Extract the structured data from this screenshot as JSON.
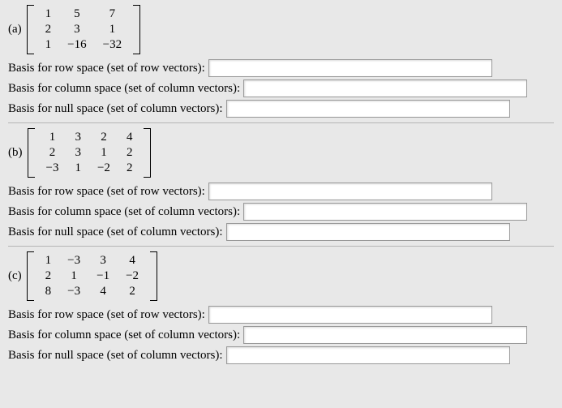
{
  "problems": [
    {
      "label": "(a)",
      "matrix": [
        [
          "1",
          "5",
          "7"
        ],
        [
          "2",
          "3",
          "1"
        ],
        [
          "1",
          "−16",
          "−32"
        ]
      ]
    },
    {
      "label": "(b)",
      "matrix": [
        [
          "1",
          "3",
          "2",
          "4"
        ],
        [
          "2",
          "3",
          "1",
          "2"
        ],
        [
          "−3",
          "1",
          "−2",
          "2"
        ]
      ]
    },
    {
      "label": "(c)",
      "matrix": [
        [
          "1",
          "−3",
          "3",
          "4"
        ],
        [
          "2",
          "1",
          "−1",
          "−2"
        ],
        [
          "8",
          "−3",
          "4",
          "2"
        ]
      ]
    }
  ],
  "prompts": {
    "row": "Basis for row space (set of row vectors):",
    "col": "Basis for column space (set of column vectors):",
    "null": "Basis for null space (set of column vectors):"
  }
}
